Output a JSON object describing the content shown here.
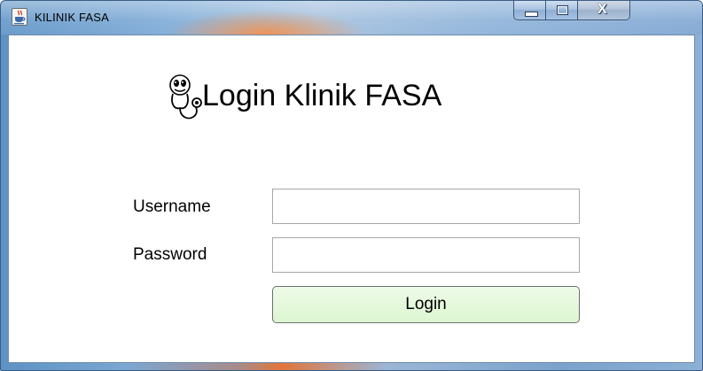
{
  "window": {
    "title": "KILINIK FASA",
    "title_icon": "java-cup-icon",
    "controls": {
      "minimize_icon": "minimize-icon",
      "maximize_icon": "maximize-icon",
      "close_icon": "close-icon",
      "close_glyph": "X"
    }
  },
  "header": {
    "logo_icon": "stethoscope-icon",
    "title": "Login Klinik FASA"
  },
  "form": {
    "username_label": "Username",
    "username_value": "",
    "password_label": "Password",
    "password_value": "",
    "login_label": "Login"
  },
  "colors": {
    "login_button": "#dcf6d0",
    "content_background": "#ffffff"
  }
}
